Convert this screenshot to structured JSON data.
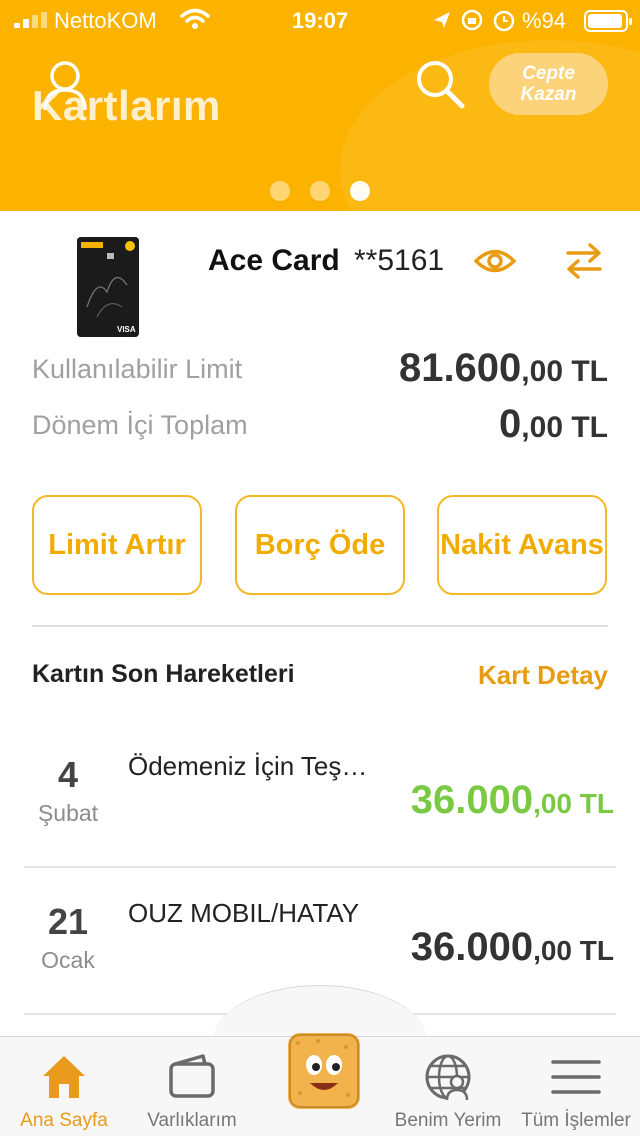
{
  "status_bar": {
    "carrier": "NettoKOM",
    "time": "19:07",
    "battery_percent": "%94"
  },
  "header": {
    "title": "Kartlarım",
    "promo_line1": "Cepte",
    "promo_line2": "Kazan",
    "carousel_pages": 3,
    "carousel_active_index": 2
  },
  "card": {
    "name": "Ace Card",
    "number_masked": "**5161"
  },
  "limits": {
    "available_label": "Kullanılabilir Limit",
    "available_int": "81.600",
    "available_frac": ",00 TL",
    "period_label": "Dönem İçi Toplam",
    "period_int": "0",
    "period_frac": ",00 TL"
  },
  "actions": {
    "limit_increase": "Limit Artır",
    "pay_debt": "Borç Öde",
    "cash_advance": "Nakit Avans"
  },
  "transactions": {
    "title": "Kartın Son Hareketleri",
    "detail_link": "Kart Detay",
    "items": [
      {
        "day": "4",
        "month": "Şubat",
        "description": "Ödemeniz İçin Teş…",
        "amount_int": "36.000",
        "amount_frac": ",00 TL",
        "amount_color": "#7ac943"
      },
      {
        "day": "21",
        "month": "Ocak",
        "description": "OUZ MOBIL/HATAY",
        "amount_int": "36.000",
        "amount_frac": ",00 TL",
        "amount_color": "#333333"
      }
    ]
  },
  "nav": {
    "home": "Ana Sayfa",
    "assets": "Varlıklarım",
    "my_place": "Benim Yerim",
    "all_ops": "Tüm İşlemler",
    "active_color": "#e99a1c"
  },
  "colors": {
    "brand": "#fbb300",
    "accent_text": "#f2ab00",
    "positive": "#7ac943"
  },
  "icons": [
    "user-icon",
    "search-icon",
    "eye-icon",
    "swap-icon",
    "home-icon",
    "wallet-icon",
    "globe-user-icon",
    "menu-icon",
    "mascot-icon"
  ]
}
